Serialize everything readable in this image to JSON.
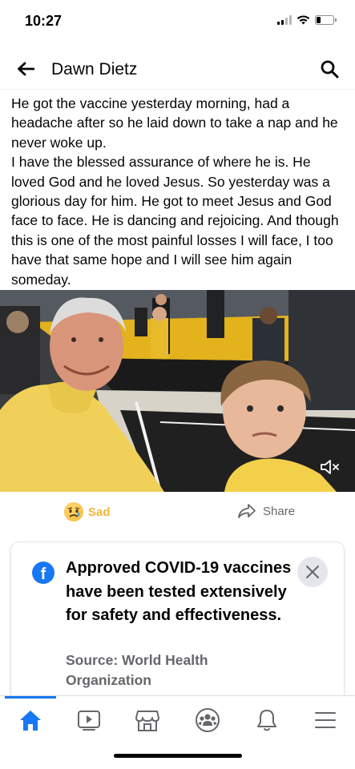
{
  "status_bar": {
    "time": "10:27",
    "battery_fraction": 0.25
  },
  "header": {
    "title": "Dawn Dietz",
    "back_icon": "arrow-left-icon",
    "search_icon": "search-icon"
  },
  "post": {
    "paragraphs": [
      "He got the vaccine yesterday morning, had a headache after so he laid down to take a nap and he never woke up.",
      "I have the blessed assurance of where he is. He loved God and he loved Jesus. So yesterday was a glorious day for him. He got to meet Jesus and God face to face. He is dancing and rejoicing. And though this is one of the most painful losses I will face, I too have that same hope and I will see him again someday."
    ]
  },
  "photo": {
    "mute_icon": "speaker-muted-icon"
  },
  "reactions": {
    "sad_label": "Sad",
    "share_label": "Share",
    "sad_color": "#f0b63a"
  },
  "info_card": {
    "heading": "Approved COVID-19 vaccines have been tested extensively for safety and effectiveness.",
    "source": "Source: World Health Organization",
    "icon": "facebook-icon",
    "close_icon": "close-icon"
  },
  "tab_bar": {
    "active_color": "#1877f2",
    "tabs": [
      "home-icon",
      "watch-icon",
      "marketplace-icon",
      "groups-icon",
      "notifications-icon",
      "menu-icon"
    ]
  }
}
